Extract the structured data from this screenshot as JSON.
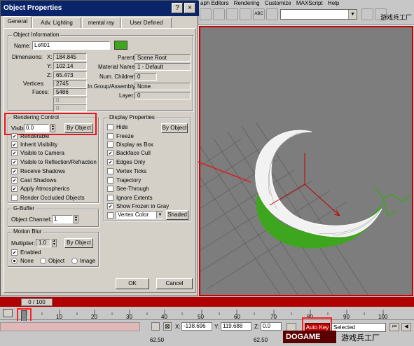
{
  "app_menu": [
    "aph Editors",
    "Rendering",
    "Customize",
    "MAXScript",
    "Help"
  ],
  "toolbar": {
    "abc_label": "ABC",
    "watermark_cjk": "游戏兵工厂"
  },
  "dialog": {
    "title": "Object Properties",
    "close_glyph": "×",
    "help_glyph": "?",
    "tabs": [
      "General",
      "Adv. Lighting",
      "mental ray",
      "User Defined"
    ],
    "object_info": {
      "title": "Object Information",
      "name_label": "Name:",
      "name_value": "Loft01",
      "dimensions_label": "Dimensions:",
      "x_label": "X:",
      "x_value": "184.845",
      "y_label": "Y:",
      "y_value": "102.14",
      "z_label": "Z:",
      "z_value": "65.473",
      "vertices_label": "Vertices:",
      "vertices_value": "2745",
      "faces_label": "Faces:",
      "faces_value": "5486",
      "extra_1": "0",
      "extra_2": "0",
      "parent_label": "Parent:",
      "parent_value": "Scene Root",
      "material_label": "Material Name:",
      "material_value": "1 - Default",
      "children_label": "Num. Children:",
      "children_value": "0",
      "group_label": "In Group/Assembly:",
      "group_value": "None",
      "layer_label": "Layer:",
      "layer_value": "0",
      "color": "#3da51e"
    },
    "rendering_control": {
      "title": "Rendering Control",
      "visibility_label": "Visibility:",
      "visibility_value": "0.0",
      "by_object": "By Object",
      "options": [
        {
          "label": "Renderable",
          "checked": true
        },
        {
          "label": "Inherit Visibility",
          "checked": true
        },
        {
          "label": "Visible to Camera",
          "checked": true
        },
        {
          "label": "Visible to Reflection/Refraction",
          "checked": true
        },
        {
          "label": "Receive Shadows",
          "checked": true
        },
        {
          "label": "Cast Shadows",
          "checked": true
        },
        {
          "label": "Apply Atmospherics",
          "checked": true
        },
        {
          "label": "Render Occluded Objects",
          "checked": false
        }
      ]
    },
    "display_properties": {
      "title": "Display Properties",
      "by_object": "By Object",
      "options": [
        {
          "label": "Hide",
          "checked": false
        },
        {
          "label": "Freeze",
          "checked": false
        },
        {
          "label": "Display as Box",
          "checked": false
        },
        {
          "label": "Backface Cull",
          "checked": true
        },
        {
          "label": "Edges Only",
          "checked": true
        },
        {
          "label": "Vertex Ticks",
          "checked": false
        },
        {
          "label": "Trajectory",
          "checked": false
        },
        {
          "label": "See-Through",
          "checked": false
        },
        {
          "label": "Ignore Extents",
          "checked": false
        },
        {
          "label": "Show Frozen in Gray",
          "checked": true
        }
      ],
      "vertex_color_checked": false,
      "vertex_color_value": "Vertex Color",
      "shaded_button": "Shaded"
    },
    "gbuffer": {
      "title": "G-Buffer",
      "channel_label": "Object Channel:",
      "channel_value": "1"
    },
    "motion_blur": {
      "title": "Motion Blur",
      "multiplier_label": "Multiplier:",
      "multiplier_value": "1.0",
      "by_object": "By Object",
      "enabled_label": "Enabled",
      "enabled_checked": true,
      "none_label": "None",
      "object_label": "Object",
      "image_label": "Image",
      "selected": "None"
    },
    "ok_button": "OK",
    "cancel_button": "Cancel"
  },
  "timeline": {
    "frame_slider": "0 / 100",
    "ticks": [
      "10",
      "20",
      "30",
      "40",
      "50",
      "60",
      "70",
      "80",
      "90",
      "100"
    ]
  },
  "statusbar": {
    "x_label": "X:",
    "x_value": "-138.696",
    "y_label": "Y:",
    "y_value": "119.688",
    "z_label": "Z:",
    "z_value": "0.0",
    "autokey": "Auto Key",
    "selected_value": "Selected",
    "left_value": "62.50",
    "mid_value": "62.50",
    "dogame": "DOGAME",
    "watermark_cjk": "游戏兵工厂"
  },
  "colors": {
    "highlight_red": "#e8141a",
    "titlebar": "#0a246a",
    "object_green": "#3da51e"
  }
}
